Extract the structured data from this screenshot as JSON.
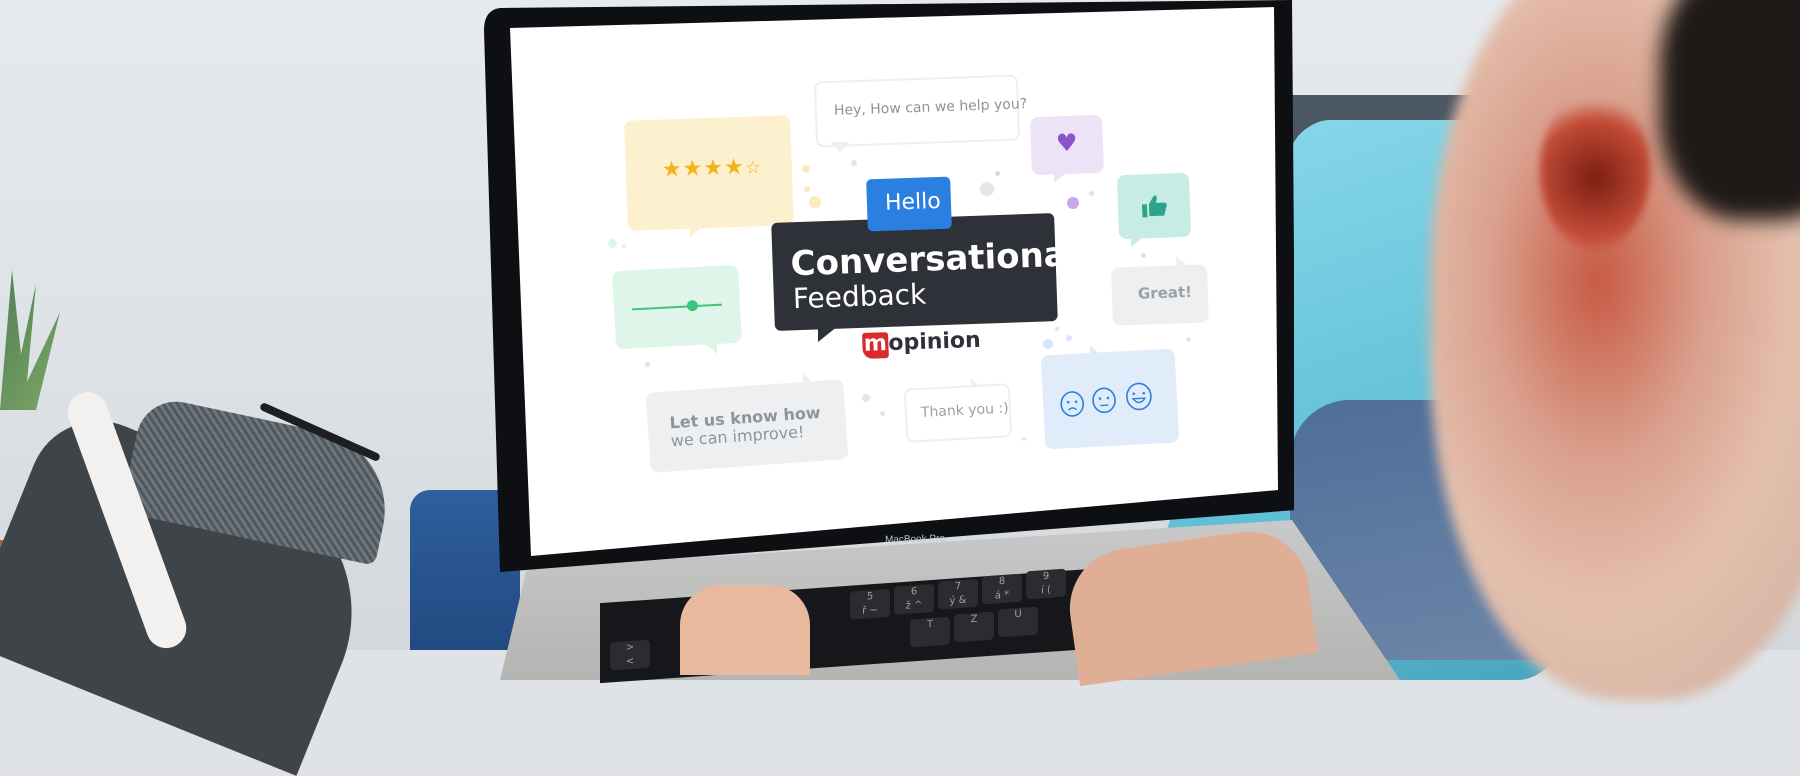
{
  "scene": {
    "device": "MacBook Pro",
    "device_label": "MacBook Pro"
  },
  "screen": {
    "brand_colors": {
      "primary_blue": "#2b7fe0",
      "dark_panel": "#2f3138",
      "logo_red": "#d92b2b"
    },
    "hero": {
      "greeting": "Hello",
      "title_line1": "Conversational",
      "title_line2": "Feedback"
    },
    "logo": {
      "mark": "m",
      "wordmark": "opinion",
      "full": "mopinion"
    },
    "bubbles": {
      "help_question": "Hey, How can we help you?",
      "rating": {
        "icon": "star-icon",
        "value": 4,
        "max": 5,
        "color": "#f2b31b",
        "background": "#fdf0cf"
      },
      "heart": {
        "icon": "heart-icon",
        "color": "#8a52cc",
        "background": "#ece3f6"
      },
      "thumbs_up": {
        "icon": "thumbs-up-icon",
        "color": "#2ea38b",
        "background": "#c6ece3"
      },
      "great": "Great!",
      "slider": {
        "value_fraction": 0.75,
        "color": "#3cc57a",
        "background": "#e0f5ea"
      },
      "improve_line1": "Let us know how",
      "improve_line2": "we can improve!",
      "thanks": "Thank you :)",
      "faces": {
        "icons": [
          "sad-face-icon",
          "neutral-face-icon",
          "happy-face-icon"
        ],
        "color": "#2b7fe0",
        "background": "#e1ecfb"
      }
    }
  }
}
